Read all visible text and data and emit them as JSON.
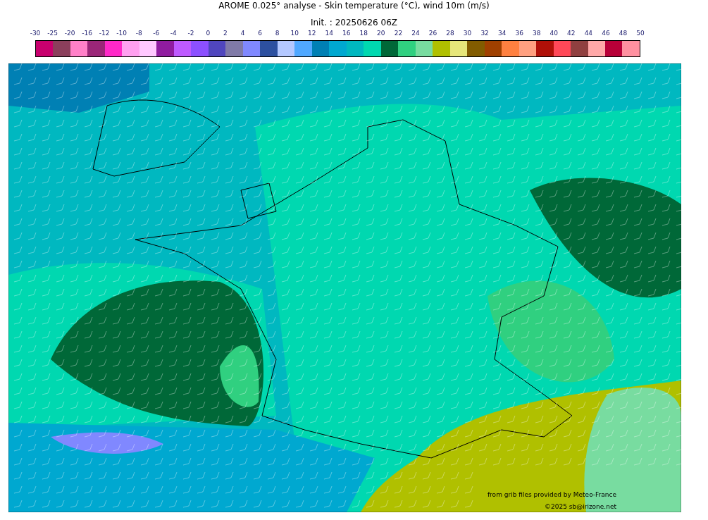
{
  "title": "AROME 0.025° analyse - Skin temperature (°C), wind 10m (m/s)",
  "subtitle": "Init. : 20250626 06Z",
  "colorbar": {
    "ticks": [
      "-30",
      "-25",
      "-20",
      "-16",
      "-12",
      "-10",
      "-8",
      "-6",
      "-4",
      "-2",
      "0",
      "2",
      "4",
      "6",
      "8",
      "10",
      "12",
      "14",
      "16",
      "18",
      "20",
      "22",
      "24",
      "26",
      "28",
      "30",
      "32",
      "34",
      "36",
      "38",
      "40",
      "42",
      "44",
      "46",
      "48",
      "50"
    ],
    "bins": [
      {
        "color": "#c8006e"
      },
      {
        "color": "#8b3f5c"
      },
      {
        "color": "#ff80c8"
      },
      {
        "color": "#9b2678"
      },
      {
        "color": "#ff28c8"
      },
      {
        "color": "#ffa0f0"
      },
      {
        "color": "#ffc8ff"
      },
      {
        "color": "#901ca0"
      },
      {
        "color": "#be5aff"
      },
      {
        "color": "#8c50ff"
      },
      {
        "color": "#5046be"
      },
      {
        "color": "#807aa8"
      },
      {
        "color": "#8088ff"
      },
      {
        "color": "#2d50a0"
      },
      {
        "color": "#b4c8ff"
      },
      {
        "color": "#50a8ff"
      },
      {
        "color": "#0080b4"
      },
      {
        "color": "#00a8d0"
      },
      {
        "color": "#00b8c0"
      },
      {
        "color": "#00d8b0"
      },
      {
        "color": "#006838"
      },
      {
        "color": "#30d080"
      },
      {
        "color": "#78dca0"
      },
      {
        "color": "#b0c000"
      },
      {
        "color": "#e6e67a"
      },
      {
        "color": "#825c00"
      },
      {
        "color": "#a04000"
      },
      {
        "color": "#ff8040"
      },
      {
        "color": "#ffa080"
      },
      {
        "color": "#b01008"
      },
      {
        "color": "#ff4858"
      },
      {
        "color": "#904040"
      },
      {
        "color": "#ffa8a8"
      },
      {
        "color": "#b80038"
      },
      {
        "color": "#ff90a0"
      }
    ]
  },
  "credits": [
    "from grib files provided by Meteo-France",
    "©2025 sb@irizone.net"
  ]
}
